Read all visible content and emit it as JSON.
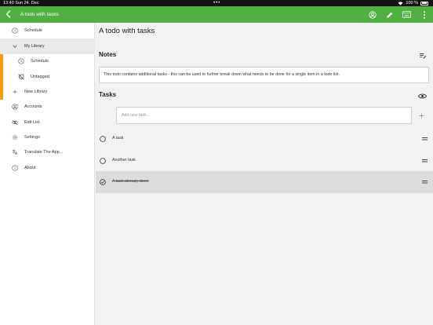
{
  "status_bar": {
    "time_date": "13:40  Sun 24. Dec",
    "dots": "•••",
    "battery": "100 %"
  },
  "app_bar": {
    "title": "A todo with tasks",
    "icons": [
      "back-arrow-icon",
      "account-circle-icon",
      "pencil-icon",
      "keyboard-icon",
      "more-vert-icon"
    ]
  },
  "sidebar": {
    "items": [
      {
        "label": "Schedule",
        "icon": "clock-icon"
      },
      {
        "label": "My Library",
        "icon": "chevron-down-icon"
      },
      {
        "label": "Schedule",
        "icon": "clock-icon"
      },
      {
        "label": "Untagged",
        "icon": "tag-off-icon"
      },
      {
        "label": "New Library",
        "icon": "plus-icon"
      },
      {
        "label": "Accounts",
        "icon": "account-circle-icon"
      },
      {
        "label": "Edit List",
        "icon": "eye-off-icon"
      },
      {
        "label": "Settings",
        "icon": "gear-icon"
      },
      {
        "label": "Translate The App...",
        "icon": "translate-icon"
      },
      {
        "label": "About",
        "icon": "info-icon"
      }
    ]
  },
  "main": {
    "title": "A todo with tasks",
    "notes_heading": "Notes",
    "notes_text": "This todo contains additional tasks - this can be used to further break down what needs to be done for a single item in a todo list.",
    "tasks_heading": "Tasks",
    "task_input_placeholder": "Add new task...",
    "tasks": [
      {
        "label": "A task",
        "done": false
      },
      {
        "label": "Another task",
        "done": false
      },
      {
        "label": "A task already done",
        "done": true
      }
    ]
  },
  "colors": {
    "accent_green": "#52b043",
    "library_orange": "#f39c12"
  }
}
